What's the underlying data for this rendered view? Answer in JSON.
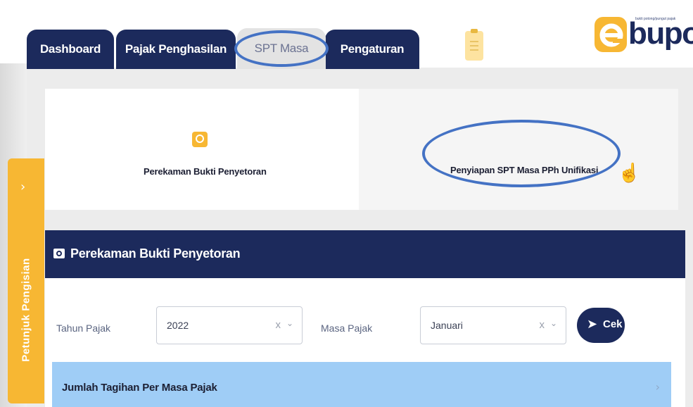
{
  "tabs": [
    {
      "label": "Dashboard"
    },
    {
      "label": "Pajak Penghasilan"
    },
    {
      "label": "SPT Masa",
      "active": true
    },
    {
      "label": "Pengaturan"
    }
  ],
  "logo": {
    "text": "bupot",
    "tagline": "bukti potong/pungut pajak"
  },
  "cards": {
    "left": {
      "label": "Perekaman Bukti Penyetoran"
    },
    "right": {
      "label": "Penyiapan SPT Masa PPh Unifikasi"
    }
  },
  "side_tab": {
    "label": "Petunjuk Pengisian"
  },
  "section": {
    "title": "Perekaman Bukti Penyetoran"
  },
  "form": {
    "tahun_label": "Tahun Pajak",
    "tahun_value": "2022",
    "masa_label": "Masa Pajak",
    "masa_value": "Januari",
    "clear_symbol": "x",
    "cek_label": "Cek"
  },
  "accordion": {
    "title": "Jumlah Tagihan Per Masa Pajak"
  },
  "colors": {
    "navy": "#1c2a5c",
    "accent": "#f7b733",
    "highlight": "#4472c4",
    "accordion": "#9fcdf6"
  }
}
